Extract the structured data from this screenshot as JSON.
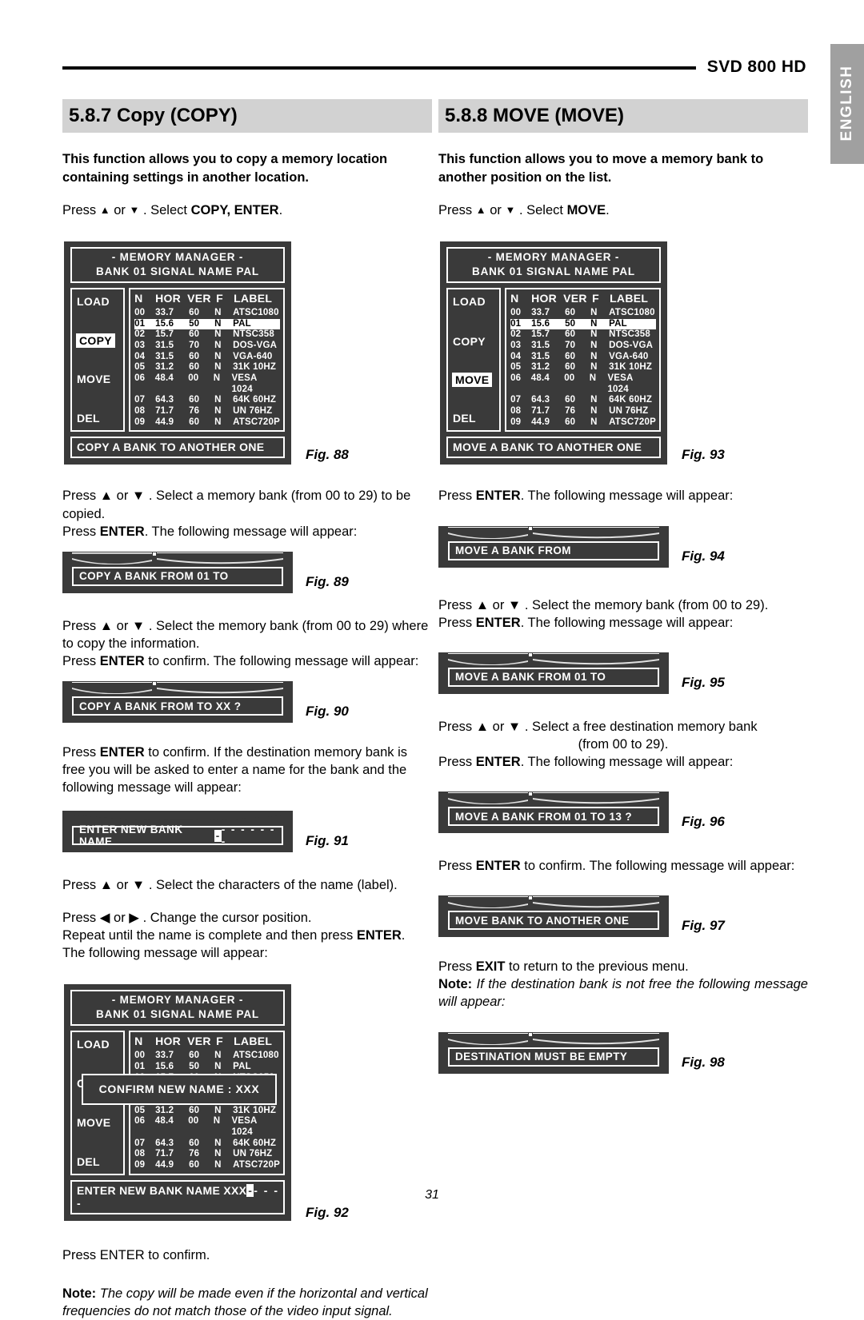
{
  "header": {
    "model": "SVD 800 HD",
    "language_tab": "ENGLISH"
  },
  "page_number": "31",
  "left_column": {
    "section": {
      "number": "5.8.7",
      "title": "Copy (COPY)",
      "heading": "5.8.7 Copy (COPY)"
    },
    "intro": "This function allows you to copy a memory location containing settings in another location.",
    "step1_pre": "Press ",
    "step1_mid": " or ",
    "step1_post": " . Select ",
    "step1_bold": "COPY, ENTER",
    "step1_end": ".",
    "fig88_caption": "Fig. 88",
    "para2_line1": "Press ▲ or ▼ . Select a memory bank (from 00 to 29) to be copied.",
    "para2_line2_pre": "Press ",
    "para2_line2_bold": "ENTER",
    "para2_line2_post": ". The following message will appear:",
    "fig89_caption": "Fig. 89",
    "fig89_message": "COPY A BANK FROM   01  TO",
    "para3_line1": "Press ▲ or ▼ . Select the memory bank (from 00 to 29) where to copy the information.",
    "para3_line2_pre": "Press ",
    "para3_line2_bold": "ENTER",
    "para3_line2_post": " to confirm. The following message will appear:",
    "fig90_caption": "Fig. 90",
    "fig90_message": "COPY A BANK FROM  TO  XX  ?",
    "para4_pre": "Press ",
    "para4_bold": "ENTER",
    "para4_post": " to confirm. If the destination memory bank is free you will be asked to enter a name for the bank and the following message will appear:",
    "fig91_caption": "Fig. 91",
    "fig91_message": "ENTER NEW BANK NAME",
    "fig91_cursor": "-",
    "fig91_dashes": "- - - - - - -",
    "para5": "Press ▲ or ▼ . Select the characters of the name (label).",
    "para6": "Press ◀ or ▶ . Change the cursor position.",
    "para7_pre": "Repeat until the name is complete and then press ",
    "para7_bold": "ENTER",
    "para7_post": ".",
    "para7_line2": "The following message will appear:",
    "fig92_caption": "Fig. 92",
    "fig92_confirm": "CONFIRM NEW NAME  :   XXX",
    "fig92_footer_label": "ENTER NEW BANK NAME",
    "fig92_footer_name": "XXX",
    "fig92_footer_cursor": "-",
    "fig92_footer_dashes": "- - - -",
    "para8": "Press ENTER to confirm.",
    "note_label": "Note:",
    "note_text": "The copy will be made even if the horizontal and vertical frequencies do not match those of the video input signal."
  },
  "right_column": {
    "section": {
      "number": "5.8.8",
      "title": "MOVE (MOVE)",
      "heading": "5.8.8 MOVE (MOVE)"
    },
    "intro": "This function allows you to move a memory bank to another position on the list.",
    "step1_post": " . Select ",
    "step1_bold": "MOVE",
    "step1_end": ".",
    "fig93_caption": "Fig. 93",
    "para2_pre": "Press ",
    "para2_bold": "ENTER",
    "para2_post": ". The following message will appear:",
    "fig94_caption": "Fig. 94",
    "fig94_message": "MOVE A BANK FROM",
    "para3_line1": "Press ▲ or ▼ . Select the memory bank (from 00 to 29).",
    "para3_line2_pre": "Press ",
    "para3_line2_bold": "ENTER",
    "para3_line2_post": ". The following message will appear:",
    "fig95_caption": "Fig. 95",
    "fig95_message": "MOVE A BANK FROM   01  TO",
    "para4_line1": "Press ▲ or ▼ . Select a free destination memory bank",
    "para4_line2": "(from 00 to 29).",
    "para4_line3_pre": "Press ",
    "para4_line3_bold": "ENTER",
    "para4_line3_post": ". The following message will appear:",
    "fig96_caption": "Fig. 96",
    "fig96_message": "MOVE A BANK FROM   01  TO  13  ?",
    "para5_pre": "Press ",
    "para5_bold": "ENTER",
    "para5_post": " to confirm. The following message will appear:",
    "fig97_caption": "Fig. 97",
    "fig97_message": "MOVE BANK TO ANOTHER ONE",
    "para6_pre": "Press ",
    "para6_bold": "EXIT",
    "para6_post": " to return to the previous menu.",
    "note_label": "Note:",
    "note_text": "If the destination bank is not free the following message will appear:",
    "fig98_caption": "Fig. 98",
    "fig98_message": "DESTINATION MUST BE EMPTY"
  },
  "osd": {
    "title_line1": "-  MEMORY MANAGER  -",
    "title_line2": "BANK    01  SIGNAL  NAME    PAL",
    "menu_copy": [
      "LOAD",
      "COPY",
      "MOVE",
      "DEL"
    ],
    "menu_selected_copy": "COPY",
    "menu_selected_move": "MOVE",
    "columns": [
      "N",
      "HOR",
      "VER",
      "F",
      "LABEL"
    ],
    "rows": [
      {
        "n": "00",
        "hor": "33.7",
        "ver": "60",
        "f": "N",
        "label": "ATSC1080"
      },
      {
        "n": "01",
        "hor": "15.6",
        "ver": "50",
        "f": "N",
        "label": "PAL"
      },
      {
        "n": "02",
        "hor": "15.7",
        "ver": "60",
        "f": "N",
        "label": "NTSC358"
      },
      {
        "n": "03",
        "hor": "31.5",
        "ver": "70",
        "f": "N",
        "label": "DOS-VGA"
      },
      {
        "n": "04",
        "hor": "31.5",
        "ver": "60",
        "f": "N",
        "label": "VGA-640"
      },
      {
        "n": "05",
        "hor": "31.2",
        "ver": "60",
        "f": "N",
        "label": "31K  10HZ"
      },
      {
        "n": "06",
        "hor": "48.4",
        "ver": "00",
        "f": "N",
        "label": "VESA 1024"
      },
      {
        "n": "07",
        "hor": "64.3",
        "ver": "60",
        "f": "N",
        "label": "64K  60HZ"
      },
      {
        "n": "08",
        "hor": "71.7",
        "ver": "76",
        "f": "N",
        "label": "UN    76HZ"
      },
      {
        "n": "09",
        "hor": "44.9",
        "ver": "60",
        "f": "N",
        "label": "ATSC720P"
      }
    ],
    "selected_row": "01",
    "footer_copy": "COPY A BANK TO ANOTHER ONE",
    "footer_move": "MOVE A BANK TO ANOTHER ONE"
  },
  "colors": {
    "osd_bg": "#3a3a3a",
    "section_header_bg": "#d2d2d2",
    "lang_tab_bg": "#a0a0a0",
    "text": "#000000"
  }
}
